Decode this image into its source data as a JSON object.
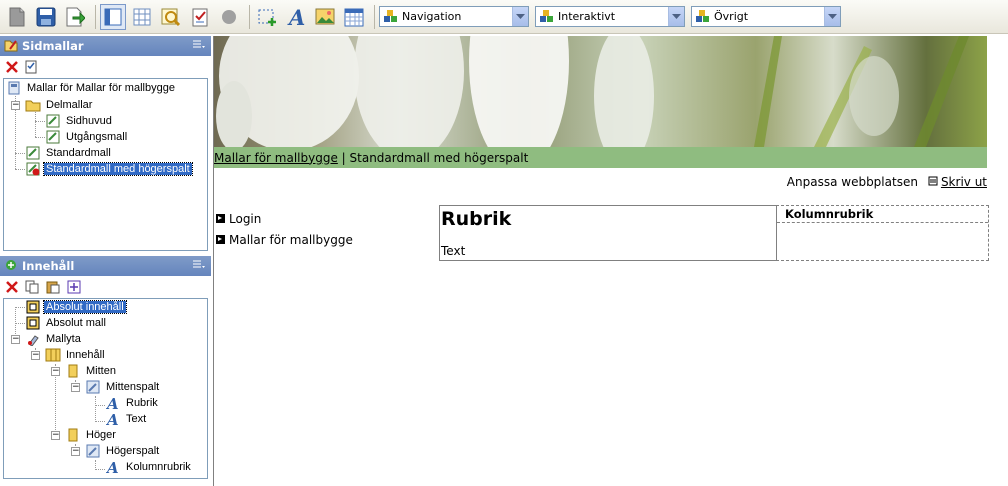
{
  "toolbar": {
    "icons": [
      "new-page-icon",
      "save-icon",
      "publish-icon",
      "layout-icon",
      "grid-icon",
      "preview-icon",
      "validate-icon",
      "record-icon",
      "add-region-icon",
      "text-icon",
      "image-icon",
      "calendar-icon"
    ],
    "dropdowns": [
      {
        "label": "Navigation",
        "icon": "components-icon"
      },
      {
        "label": "Interaktivt",
        "icon": "components-icon"
      },
      {
        "label": "Övrigt",
        "icon": "components-icon"
      }
    ]
  },
  "sidmallar": {
    "title": "Sidmallar",
    "tree": [
      {
        "label": "Mallar för Mallar för mallbygge",
        "icon": "site-icon"
      },
      {
        "label": "Delmallar",
        "icon": "folder-icon"
      },
      {
        "label": "Sidhuvud",
        "icon": "page-icon"
      },
      {
        "label": "Utgångsmall",
        "icon": "page-icon"
      },
      {
        "label": "Standardmall",
        "icon": "page-icon"
      },
      {
        "label": "Standardmall med högerspalt",
        "icon": "page-error-icon"
      }
    ]
  },
  "innehall": {
    "title": "Innehåll",
    "tree": [
      {
        "label": "Absolut innehåll",
        "icon": "absolute-icon"
      },
      {
        "label": "Absolut mall",
        "icon": "absolute-icon"
      },
      {
        "label": "Mallyta",
        "icon": "brush-icon"
      },
      {
        "label": "Innehåll",
        "icon": "columns-icon"
      },
      {
        "label": "Mitten",
        "icon": "column-icon"
      },
      {
        "label": "Mittenspalt",
        "icon": "portlet-icon"
      },
      {
        "label": "Rubrik",
        "icon": "text-icon"
      },
      {
        "label": "Text",
        "icon": "text-icon"
      },
      {
        "label": "Höger",
        "icon": "column-icon"
      },
      {
        "label": "Högerspalt",
        "icon": "portlet-icon"
      },
      {
        "label": "Kolumnrubrik",
        "icon": "text-icon"
      }
    ]
  },
  "page": {
    "breadcrumb_link": "Mallar för mallbygge",
    "breadcrumb_sep": " | ",
    "breadcrumb_current": "Standardmall med högerspalt",
    "customize": "Anpassa webbplatsen",
    "print": "Skriv ut",
    "nav": [
      "Login",
      "Mallar för mallbygge"
    ],
    "rubrik": "Rubrik",
    "text": "Text",
    "kolumnrubrik": "Kolumnrubrik"
  }
}
